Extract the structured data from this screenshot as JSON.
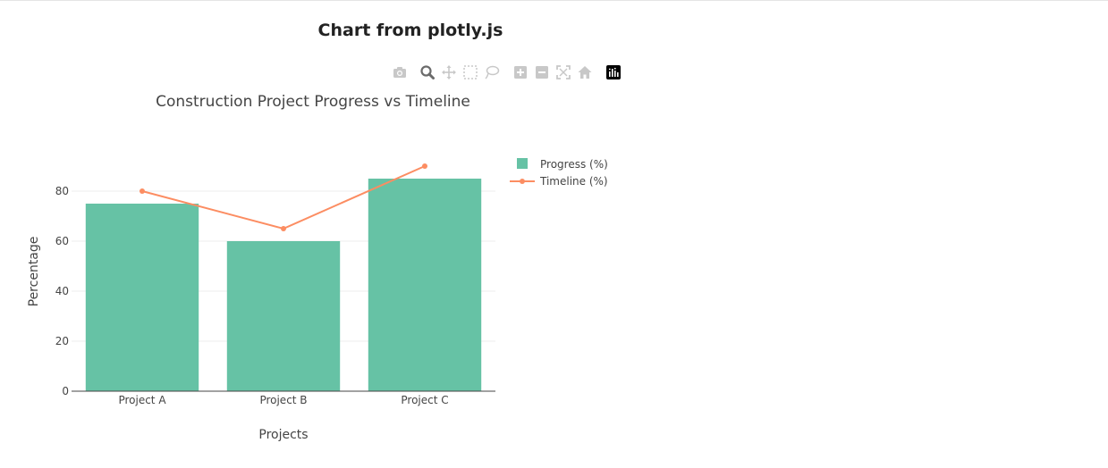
{
  "page": {
    "title": "Chart from plotly.js"
  },
  "modebar": {
    "icons": [
      "camera-icon",
      "zoom-icon",
      "pan-icon",
      "box-select-icon",
      "lasso-select-icon",
      "zoom-in-icon",
      "zoom-out-icon",
      "autoscale-icon",
      "reset-axes-icon",
      "plotly-logo-icon"
    ],
    "icon_color": "#c8c8c8",
    "active_color": "#6b6b6b"
  },
  "chart_data": {
    "type": "bar",
    "title": "Construction Project Progress vs Timeline",
    "xlabel": "Projects",
    "ylabel": "Percentage",
    "categories": [
      "Project A",
      "Project B",
      "Project C"
    ],
    "ylim": [
      0,
      90
    ],
    "yticks": [
      0,
      20,
      40,
      60,
      80
    ],
    "grid": true,
    "legend_position": "top-right",
    "series": [
      {
        "name": "Progress (%)",
        "type": "bar",
        "values": [
          75,
          60,
          85
        ],
        "color": "#66c2a5"
      },
      {
        "name": "Timeline (%)",
        "type": "line",
        "values": [
          80,
          65,
          90
        ],
        "color": "#fc8d62"
      }
    ]
  }
}
